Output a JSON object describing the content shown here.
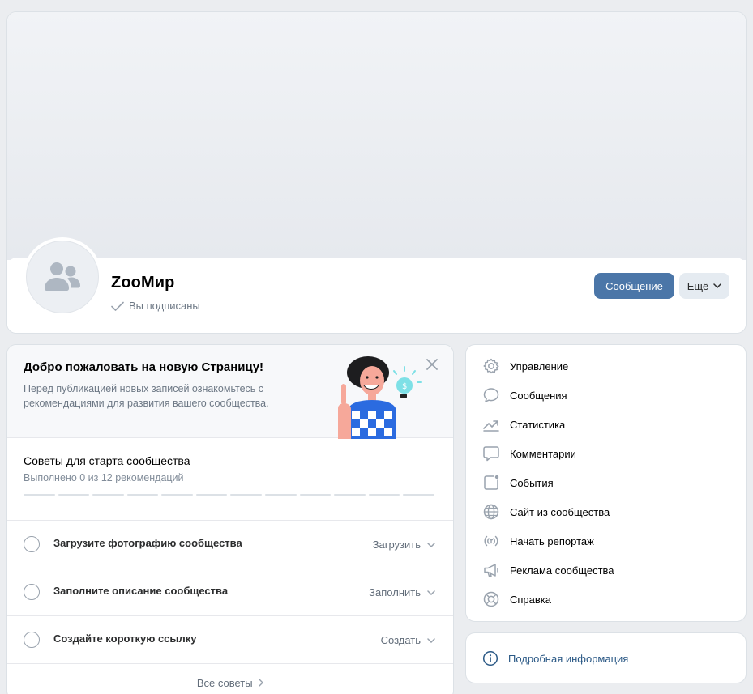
{
  "community": {
    "name": "ZooМир",
    "subscribed_text": "Вы подписаны",
    "message_button": "Сообщение",
    "more_button": "Ещё"
  },
  "welcome": {
    "title": "Добро пожаловать на новую Страницу!",
    "text": "Перед публикацией новых записей ознакомьтесь с рекомендациями для развития вашего сообщества."
  },
  "tips": {
    "title": "Советы для старта сообщества",
    "progress_text": "Выполнено 0 из 12 рекомендаций",
    "completed": 0,
    "total": 12,
    "items": [
      {
        "label": "Загрузите фотографию сообщества",
        "action": "Загрузить"
      },
      {
        "label": "Заполните описание сообщества",
        "action": "Заполнить"
      },
      {
        "label": "Создайте короткую ссылку",
        "action": "Создать"
      }
    ],
    "all_tips": "Все советы"
  },
  "menu": {
    "items": [
      {
        "label": "Управление",
        "icon": "gear-icon"
      },
      {
        "label": "Сообщения",
        "icon": "chat-bubble-icon"
      },
      {
        "label": "Статистика",
        "icon": "trend-chart-icon"
      },
      {
        "label": "Комментарии",
        "icon": "comment-icon"
      },
      {
        "label": "События",
        "icon": "event-icon"
      },
      {
        "label": "Сайт из сообщества",
        "icon": "globe-icon"
      },
      {
        "label": "Начать репортаж",
        "icon": "broadcast-icon"
      },
      {
        "label": "Реклама сообщества",
        "icon": "megaphone-icon"
      },
      {
        "label": "Справка",
        "icon": "lifebuoy-icon"
      }
    ]
  },
  "info": {
    "label": "Подробная информация",
    "icon": "info-icon"
  },
  "colors": {
    "primary_button": "#4b76a8",
    "link": "#2a5885",
    "background": "#ebedf0"
  }
}
